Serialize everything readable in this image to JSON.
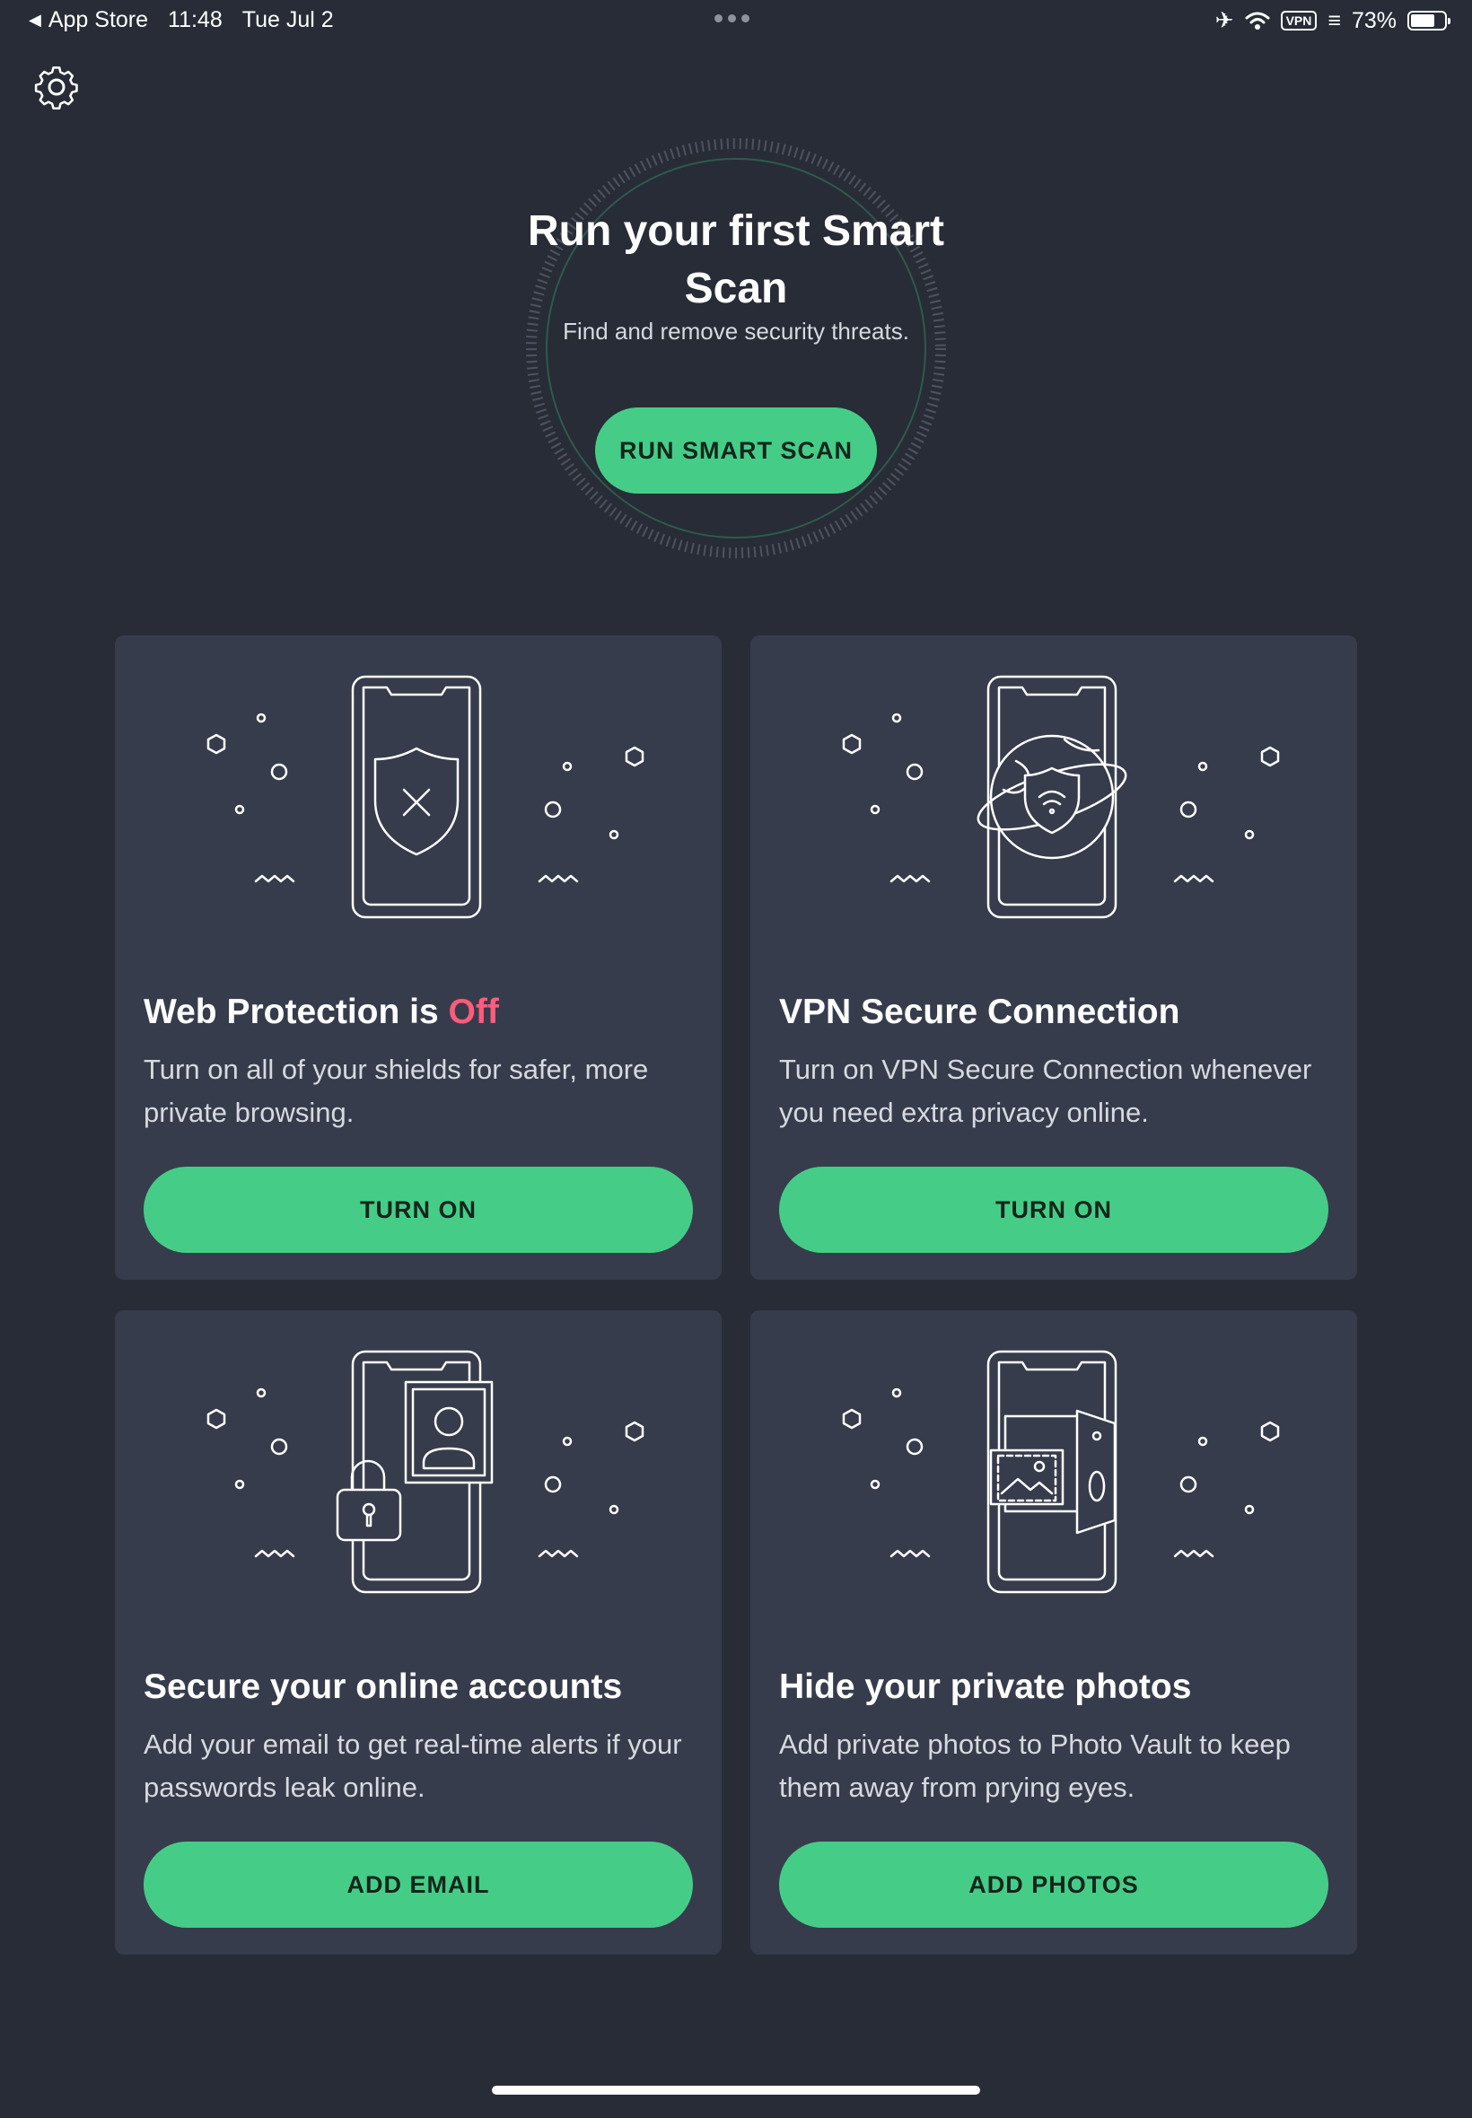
{
  "status_bar": {
    "back_label": "App Store",
    "time": "11:48",
    "date": "Tue Jul 2",
    "vpn_label": "VPN",
    "battery_percent": "73%",
    "battery_level": 0.73
  },
  "hero": {
    "title": "Run your first Smart Scan",
    "subtitle": "Find and remove security threats.",
    "button_label": "RUN SMART SCAN"
  },
  "cards": [
    {
      "title": "Web Protection is ",
      "title_status": "Off",
      "title_status_color": "#ff5b7a",
      "description": "Turn on all of your shields for safer, more private browsing.",
      "button_label": "TURN ON",
      "icon": "shield-x-icon"
    },
    {
      "title": "VPN Secure Connection",
      "description": "Turn on VPN Secure Connection whenever you need extra privacy online.",
      "button_label": "TURN ON",
      "icon": "globe-shield-icon"
    },
    {
      "title": "Secure your online accounts",
      "description": "Add your email to get real-time alerts if your passwords leak online.",
      "button_label": "ADD EMAIL",
      "icon": "account-lock-icon"
    },
    {
      "title": "Hide your private photos",
      "description": "Add private photos to Photo Vault to keep them away from prying eyes.",
      "button_label": "ADD PHOTOS",
      "icon": "photo-vault-icon"
    }
  ],
  "colors": {
    "background": "#272c36",
    "card": "#373c4c",
    "accent": "#45cd88",
    "danger": "#ff5b7a"
  }
}
